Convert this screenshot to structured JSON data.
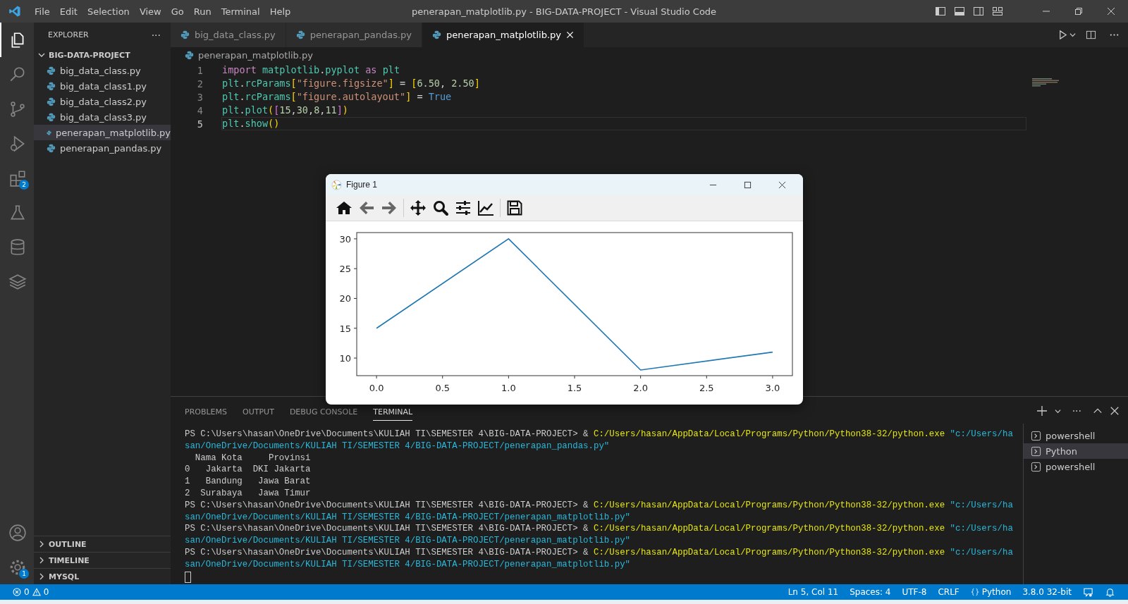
{
  "title_bar": {
    "menu": [
      "File",
      "Edit",
      "Selection",
      "View",
      "Go",
      "Run",
      "Terminal",
      "Help"
    ],
    "title": "penerapan_matplotlib.py - BIG-DATA-PROJECT - Visual Studio Code"
  },
  "activity_bar": {
    "items": [
      {
        "kind": "explorer",
        "selected": true
      },
      {
        "kind": "search",
        "selected": false
      },
      {
        "kind": "source-control",
        "selected": false
      },
      {
        "kind": "run-debug",
        "selected": false
      },
      {
        "kind": "extensions",
        "selected": false,
        "badge": "2"
      },
      {
        "kind": "testing",
        "selected": false
      },
      {
        "kind": "database",
        "selected": false
      },
      {
        "kind": "layers",
        "selected": false
      }
    ],
    "bottom": [
      {
        "kind": "account"
      },
      {
        "kind": "settings",
        "badge": "1"
      }
    ]
  },
  "sidebar": {
    "title": "EXPLORER",
    "more": "···",
    "folder": {
      "name": "BIG-DATA-PROJECT",
      "expanded": true,
      "files": [
        {
          "name": "big_data_class.py",
          "selected": false
        },
        {
          "name": "big_data_class1.py",
          "selected": false
        },
        {
          "name": "big_data_class2.py",
          "selected": false
        },
        {
          "name": "big_data_class3.py",
          "selected": false
        },
        {
          "name": "penerapan_matplotlib.py",
          "selected": true
        },
        {
          "name": "penerapan_pandas.py",
          "selected": false
        }
      ]
    },
    "sections": [
      {
        "name": "OUTLINE",
        "expanded": false
      },
      {
        "name": "TIMELINE",
        "expanded": false
      },
      {
        "name": "MYSQL",
        "expanded": false
      }
    ]
  },
  "tabs": [
    {
      "label": "big_data_class.py",
      "selected": false
    },
    {
      "label": "penerapan_pandas.py",
      "selected": false
    },
    {
      "label": "penerapan_matplotlib.py",
      "selected": true
    }
  ],
  "breadcrumb": "penerapan_matplotlib.py",
  "code": [
    {
      "number": "1",
      "current": false,
      "tokens": [
        {
          "text": "import ",
          "color": "#c586c0"
        },
        {
          "text": "matplotlib",
          "color": "#4ec9b0"
        },
        {
          "text": "."
        },
        {
          "text": "pyplot ",
          "color": "#4ec9b0"
        },
        {
          "text": "as ",
          "color": "#c586c0"
        },
        {
          "text": "plt",
          "color": "#4ec9b0"
        }
      ]
    },
    {
      "number": "2",
      "current": false,
      "tokens": [
        {
          "text": "plt",
          "color": "#4ec9b0"
        },
        {
          "text": "."
        },
        {
          "text": "rcParams",
          "color": "#4ec9b0"
        },
        {
          "text": "[",
          "color": "#ffd700"
        },
        {
          "text": "\"figure.figsize\"",
          "color": "#ce9178"
        },
        {
          "text": "]",
          "color": "#ffd700"
        },
        {
          "text": " = "
        },
        {
          "text": "[",
          "color": "#ffd700"
        },
        {
          "text": "6.50",
          "color": "#b5cea8"
        },
        {
          "text": ", "
        },
        {
          "text": "2.50",
          "color": "#b5cea8"
        },
        {
          "text": "]",
          "color": "#ffd700"
        }
      ]
    },
    {
      "number": "3",
      "current": false,
      "tokens": [
        {
          "text": "plt",
          "color": "#4ec9b0"
        },
        {
          "text": "."
        },
        {
          "text": "rcParams",
          "color": "#4ec9b0"
        },
        {
          "text": "[",
          "color": "#ffd700"
        },
        {
          "text": "\"figure.autolayout\"",
          "color": "#ce9178"
        },
        {
          "text": "]",
          "color": "#ffd700"
        },
        {
          "text": " = "
        },
        {
          "text": "True",
          "color": "#569cd6"
        }
      ]
    },
    {
      "number": "4",
      "current": false,
      "tokens": [
        {
          "text": "plt",
          "color": "#4ec9b0"
        },
        {
          "text": "."
        },
        {
          "text": "plot",
          "color": "#4ec9b0"
        },
        {
          "text": "(",
          "color": "#ffd700"
        },
        {
          "text": "[",
          "color": "#da70d6"
        },
        {
          "text": "15",
          "color": "#b5cea8"
        },
        {
          "text": ","
        },
        {
          "text": "30",
          "color": "#b5cea8"
        },
        {
          "text": ","
        },
        {
          "text": "8",
          "color": "#b5cea8"
        },
        {
          "text": ","
        },
        {
          "text": "11",
          "color": "#b5cea8"
        },
        {
          "text": "]",
          "color": "#da70d6"
        },
        {
          "text": ")",
          "color": "#ffd700"
        }
      ]
    },
    {
      "number": "5",
      "current": true,
      "tokens": [
        {
          "text": "plt",
          "color": "#4ec9b0"
        },
        {
          "text": "."
        },
        {
          "text": "show",
          "color": "#4ec9b0"
        },
        {
          "text": "()",
          "color": "#ffd700"
        }
      ]
    }
  ],
  "figure_window": {
    "title": "Figure 1",
    "toolbar": [
      {
        "kind": "home"
      },
      {
        "kind": "back"
      },
      {
        "kind": "forward"
      },
      {
        "kind": "pan"
      },
      {
        "kind": "zoom"
      },
      {
        "kind": "configure"
      },
      {
        "kind": "axes"
      },
      {
        "kind": "save"
      }
    ],
    "chart_data": {
      "type": "line",
      "x": [
        0,
        1,
        2,
        3
      ],
      "series": [
        {
          "color": "#1f77b4",
          "values": [
            15,
            30,
            8,
            11
          ]
        }
      ],
      "xlim": [
        -0.15,
        3.15
      ],
      "ylim": [
        7.05,
        31.05
      ],
      "xticks": [
        {
          "value": 0,
          "label": "0.0"
        },
        {
          "value": 0.5,
          "label": "0.5"
        },
        {
          "value": 1,
          "label": "1.0"
        },
        {
          "value": 1.5,
          "label": "1.5"
        },
        {
          "value": 2,
          "label": "2.0"
        },
        {
          "value": 2.5,
          "label": "2.5"
        },
        {
          "value": 3,
          "label": "3.0"
        }
      ],
      "yticks": [
        10,
        15,
        20,
        25,
        30
      ]
    }
  },
  "panel": {
    "tabs": [
      {
        "label": "PROBLEMS",
        "selected": false
      },
      {
        "label": "OUTPUT",
        "selected": false
      },
      {
        "label": "DEBUG CONSOLE",
        "selected": false
      },
      {
        "label": "TERMINAL",
        "selected": true
      }
    ],
    "more": "···",
    "terminal_lines": [
      [
        {
          "text": "PS C:\\Users\\hasan\\OneDrive\\Documents\\KULIAH TI\\SEMESTER 4\\BIG-DATA-PROJECT> & ",
          "color": "#cccccc"
        },
        {
          "text": "C:/Users/hasan/AppData/Local/Programs/Python/Python38-32/python.exe ",
          "color": "#e5e510"
        },
        {
          "text": "\"c:/Users/ha",
          "color": "#29b8db"
        }
      ],
      [
        {
          "text": "san/OneDrive/Documents/KULIAH TI/SEMESTER 4/BIG-DATA-PROJECT/penerapan_pandas.py\"",
          "color": "#29b8db"
        }
      ],
      [
        {
          "text": "  Nama Kota     Provinsi",
          "color": "#cccccc"
        }
      ],
      [
        {
          "text": "0   Jakarta  DKI Jakarta",
          "color": "#cccccc"
        }
      ],
      [
        {
          "text": "1   Bandung   Jawa Barat",
          "color": "#cccccc"
        }
      ],
      [
        {
          "text": "2  Surabaya   Jawa Timur",
          "color": "#cccccc"
        }
      ],
      [
        {
          "text": "PS C:\\Users\\hasan\\OneDrive\\Documents\\KULIAH TI\\SEMESTER 4\\BIG-DATA-PROJECT> & ",
          "color": "#cccccc"
        },
        {
          "text": "C:/Users/hasan/AppData/Local/Programs/Python/Python38-32/python.exe ",
          "color": "#e5e510"
        },
        {
          "text": "\"c:/Users/ha",
          "color": "#29b8db"
        }
      ],
      [
        {
          "text": "san/OneDrive/Documents/KULIAH TI/SEMESTER 4/BIG-DATA-PROJECT/penerapan_matplotlib.py\"",
          "color": "#29b8db"
        }
      ],
      [
        {
          "text": "PS C:\\Users\\hasan\\OneDrive\\Documents\\KULIAH TI\\SEMESTER 4\\BIG-DATA-PROJECT> & ",
          "color": "#cccccc"
        },
        {
          "text": "C:/Users/hasan/AppData/Local/Programs/Python/Python38-32/python.exe ",
          "color": "#e5e510"
        },
        {
          "text": "\"c:/Users/ha",
          "color": "#29b8db"
        }
      ],
      [
        {
          "text": "san/OneDrive/Documents/KULIAH TI/SEMESTER 4/BIG-DATA-PROJECT/penerapan_matplotlib.py\"",
          "color": "#29b8db"
        }
      ],
      [
        {
          "text": "PS C:\\Users\\hasan\\OneDrive\\Documents\\KULIAH TI\\SEMESTER 4\\BIG-DATA-PROJECT> & ",
          "color": "#cccccc"
        },
        {
          "text": "C:/Users/hasan/AppData/Local/Programs/Python/Python38-32/python.exe ",
          "color": "#e5e510"
        },
        {
          "text": "\"c:/Users/ha",
          "color": "#29b8db"
        }
      ],
      [
        {
          "text": "san/OneDrive/Documents/KULIAH TI/SEMESTER 4/BIG-DATA-PROJECT/penerapan_matplotlib.py\"",
          "color": "#29b8db"
        }
      ]
    ],
    "terminals": [
      {
        "name": "powershell",
        "selected": false
      },
      {
        "name": "Python",
        "selected": true
      },
      {
        "name": "powershell",
        "selected": false
      }
    ]
  },
  "status_bar": {
    "errors": "0",
    "warnings": "0",
    "right": [
      "Ln 5, Col 11",
      "Spaces: 4",
      "UTF-8",
      "CRLF"
    ],
    "language": "Python",
    "interpreter": "3.8.0 32-bit"
  }
}
